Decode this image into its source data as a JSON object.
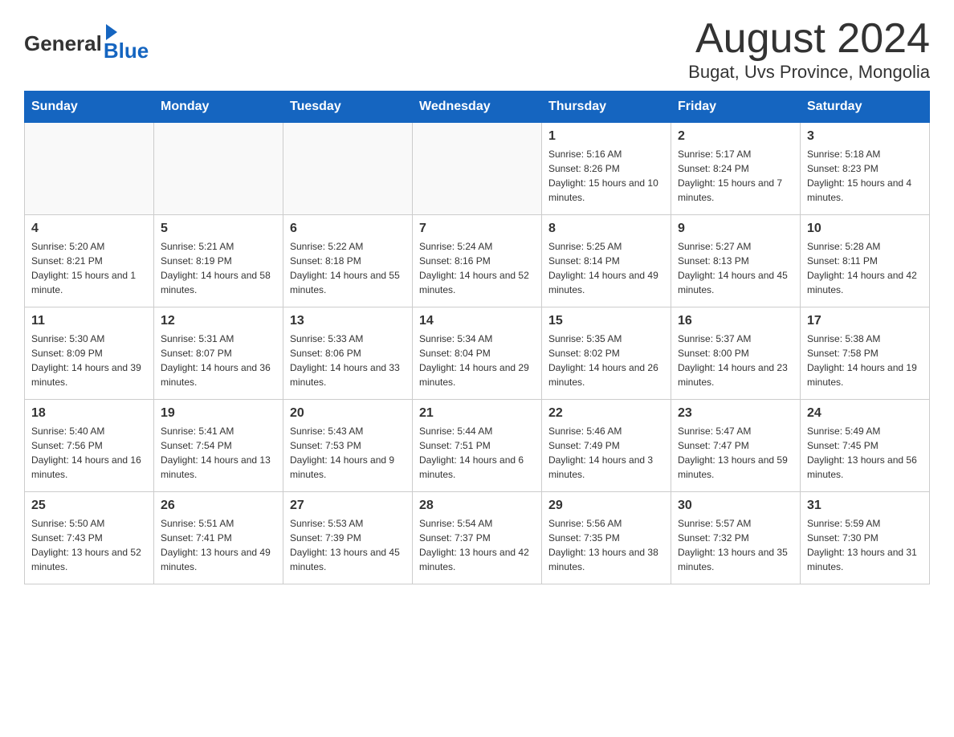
{
  "header": {
    "logo_general": "General",
    "logo_blue": "Blue",
    "month_title": "August 2024",
    "location": "Bugat, Uvs Province, Mongolia"
  },
  "days_of_week": [
    "Sunday",
    "Monday",
    "Tuesday",
    "Wednesday",
    "Thursday",
    "Friday",
    "Saturday"
  ],
  "weeks": [
    [
      {
        "day": "",
        "info": ""
      },
      {
        "day": "",
        "info": ""
      },
      {
        "day": "",
        "info": ""
      },
      {
        "day": "",
        "info": ""
      },
      {
        "day": "1",
        "info": "Sunrise: 5:16 AM\nSunset: 8:26 PM\nDaylight: 15 hours and 10 minutes."
      },
      {
        "day": "2",
        "info": "Sunrise: 5:17 AM\nSunset: 8:24 PM\nDaylight: 15 hours and 7 minutes."
      },
      {
        "day": "3",
        "info": "Sunrise: 5:18 AM\nSunset: 8:23 PM\nDaylight: 15 hours and 4 minutes."
      }
    ],
    [
      {
        "day": "4",
        "info": "Sunrise: 5:20 AM\nSunset: 8:21 PM\nDaylight: 15 hours and 1 minute."
      },
      {
        "day": "5",
        "info": "Sunrise: 5:21 AM\nSunset: 8:19 PM\nDaylight: 14 hours and 58 minutes."
      },
      {
        "day": "6",
        "info": "Sunrise: 5:22 AM\nSunset: 8:18 PM\nDaylight: 14 hours and 55 minutes."
      },
      {
        "day": "7",
        "info": "Sunrise: 5:24 AM\nSunset: 8:16 PM\nDaylight: 14 hours and 52 minutes."
      },
      {
        "day": "8",
        "info": "Sunrise: 5:25 AM\nSunset: 8:14 PM\nDaylight: 14 hours and 49 minutes."
      },
      {
        "day": "9",
        "info": "Sunrise: 5:27 AM\nSunset: 8:13 PM\nDaylight: 14 hours and 45 minutes."
      },
      {
        "day": "10",
        "info": "Sunrise: 5:28 AM\nSunset: 8:11 PM\nDaylight: 14 hours and 42 minutes."
      }
    ],
    [
      {
        "day": "11",
        "info": "Sunrise: 5:30 AM\nSunset: 8:09 PM\nDaylight: 14 hours and 39 minutes."
      },
      {
        "day": "12",
        "info": "Sunrise: 5:31 AM\nSunset: 8:07 PM\nDaylight: 14 hours and 36 minutes."
      },
      {
        "day": "13",
        "info": "Sunrise: 5:33 AM\nSunset: 8:06 PM\nDaylight: 14 hours and 33 minutes."
      },
      {
        "day": "14",
        "info": "Sunrise: 5:34 AM\nSunset: 8:04 PM\nDaylight: 14 hours and 29 minutes."
      },
      {
        "day": "15",
        "info": "Sunrise: 5:35 AM\nSunset: 8:02 PM\nDaylight: 14 hours and 26 minutes."
      },
      {
        "day": "16",
        "info": "Sunrise: 5:37 AM\nSunset: 8:00 PM\nDaylight: 14 hours and 23 minutes."
      },
      {
        "day": "17",
        "info": "Sunrise: 5:38 AM\nSunset: 7:58 PM\nDaylight: 14 hours and 19 minutes."
      }
    ],
    [
      {
        "day": "18",
        "info": "Sunrise: 5:40 AM\nSunset: 7:56 PM\nDaylight: 14 hours and 16 minutes."
      },
      {
        "day": "19",
        "info": "Sunrise: 5:41 AM\nSunset: 7:54 PM\nDaylight: 14 hours and 13 minutes."
      },
      {
        "day": "20",
        "info": "Sunrise: 5:43 AM\nSunset: 7:53 PM\nDaylight: 14 hours and 9 minutes."
      },
      {
        "day": "21",
        "info": "Sunrise: 5:44 AM\nSunset: 7:51 PM\nDaylight: 14 hours and 6 minutes."
      },
      {
        "day": "22",
        "info": "Sunrise: 5:46 AM\nSunset: 7:49 PM\nDaylight: 14 hours and 3 minutes."
      },
      {
        "day": "23",
        "info": "Sunrise: 5:47 AM\nSunset: 7:47 PM\nDaylight: 13 hours and 59 minutes."
      },
      {
        "day": "24",
        "info": "Sunrise: 5:49 AM\nSunset: 7:45 PM\nDaylight: 13 hours and 56 minutes."
      }
    ],
    [
      {
        "day": "25",
        "info": "Sunrise: 5:50 AM\nSunset: 7:43 PM\nDaylight: 13 hours and 52 minutes."
      },
      {
        "day": "26",
        "info": "Sunrise: 5:51 AM\nSunset: 7:41 PM\nDaylight: 13 hours and 49 minutes."
      },
      {
        "day": "27",
        "info": "Sunrise: 5:53 AM\nSunset: 7:39 PM\nDaylight: 13 hours and 45 minutes."
      },
      {
        "day": "28",
        "info": "Sunrise: 5:54 AM\nSunset: 7:37 PM\nDaylight: 13 hours and 42 minutes."
      },
      {
        "day": "29",
        "info": "Sunrise: 5:56 AM\nSunset: 7:35 PM\nDaylight: 13 hours and 38 minutes."
      },
      {
        "day": "30",
        "info": "Sunrise: 5:57 AM\nSunset: 7:32 PM\nDaylight: 13 hours and 35 minutes."
      },
      {
        "day": "31",
        "info": "Sunrise: 5:59 AM\nSunset: 7:30 PM\nDaylight: 13 hours and 31 minutes."
      }
    ]
  ]
}
